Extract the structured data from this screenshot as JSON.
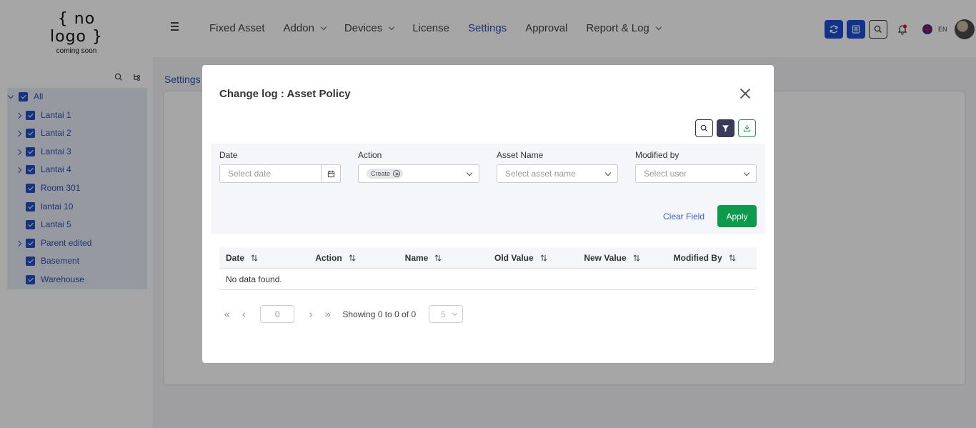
{
  "header": {
    "logo_main": "{ no logo }",
    "logo_sub": "coming soon",
    "nav": [
      {
        "label": "Fixed Asset",
        "dropdown": false,
        "active": false
      },
      {
        "label": "Addon",
        "dropdown": true,
        "active": false
      },
      {
        "label": "Devices",
        "dropdown": true,
        "active": false
      },
      {
        "label": "License",
        "dropdown": false,
        "active": false
      },
      {
        "label": "Settings",
        "dropdown": false,
        "active": true
      },
      {
        "label": "Approval",
        "dropdown": false,
        "active": false
      },
      {
        "label": "Report & Log",
        "dropdown": true,
        "active": false
      }
    ],
    "language": "EN"
  },
  "sidebar": {
    "tree": [
      {
        "label": "All",
        "expander": "open"
      },
      {
        "label": "Lantai 1",
        "expander": "closed"
      },
      {
        "label": "Lantai 2",
        "expander": "closed"
      },
      {
        "label": "Lantai 3",
        "expander": "closed"
      },
      {
        "label": "Lantai 4",
        "expander": "closed"
      },
      {
        "label": "Room 301",
        "expander": "none"
      },
      {
        "label": "lantai 10",
        "expander": "none"
      },
      {
        "label": "Lantai 5",
        "expander": "none"
      },
      {
        "label": "Parent edited",
        "expander": "closed"
      },
      {
        "label": "Basement",
        "expander": "none"
      },
      {
        "label": "Warehouse",
        "expander": "none"
      }
    ]
  },
  "background": {
    "breadcrumb": "Settings"
  },
  "modal": {
    "title": "Change log : Asset Policy",
    "filters": {
      "date_label": "Date",
      "date_placeholder": "Select date",
      "action_label": "Action",
      "action_chip": "Create",
      "asset_label": "Asset Name",
      "asset_placeholder": "Select asset name",
      "modified_label": "Modified by",
      "modified_placeholder": "Select user",
      "clear_label": "Clear Field",
      "apply_label": "Apply"
    },
    "table": {
      "columns": [
        "Date",
        "Action",
        "Name",
        "Old Value",
        "New Value",
        "Modified By"
      ],
      "empty_text": "No data found."
    },
    "pagination": {
      "page_value": "0",
      "showing_text": "Showing 0 to 0 of 0",
      "page_size": "5"
    }
  },
  "colors": {
    "accent": "#2e4fb4",
    "primary_button": "#1b4fd8",
    "apply_green": "#0d9a4c"
  }
}
